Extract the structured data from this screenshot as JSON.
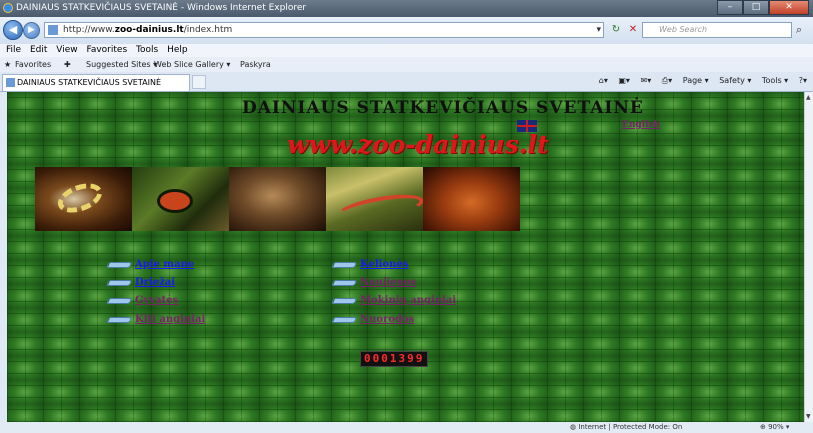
{
  "window": {
    "title": "DAINIAUS STATKEVIČIAUS SVETAINĖ - Windows Internet Explorer",
    "buttons": {
      "minimize": "–",
      "maximize": "□",
      "close": "✕"
    }
  },
  "address_bar": {
    "url_prefix": "http://www.",
    "url_domain": "zoo-dainius.lt",
    "url_path": "/index.htm",
    "search_placeholder": "Web Search"
  },
  "menu": [
    "File",
    "Edit",
    "View",
    "Favorites",
    "Tools",
    "Help"
  ],
  "favorites_bar": {
    "favorites_label": "Favorites",
    "items": [
      "Suggested Sites ▾",
      "Web Slice Gallery ▾",
      "Paskyra"
    ]
  },
  "tab": {
    "label": "DAINIAUS STATKEVIČIAUS SVETAINĖ"
  },
  "command_bar": [
    "Page ▾",
    "Safety ▾",
    "Tools ▾"
  ],
  "page": {
    "title": "DAINIAUS  STATKEVIČIAUS  SVETAINĖ",
    "logo": "www.zoo-dainius.lt",
    "english_link": "English",
    "left_links": [
      {
        "label": "Apie mane",
        "color": "#1a1aee"
      },
      {
        "label": "Driežai",
        "color": "#1a1aee"
      },
      {
        "label": "Gyvatės",
        "color": "#7a1f6a"
      },
      {
        "label": "Kiti anginiai",
        "color": "#7a1f6a"
      }
    ],
    "right_links": [
      {
        "label": "Kelionės",
        "color": "#1a1aee"
      },
      {
        "label": "Naujienos",
        "color": "#7a1f6a"
      },
      {
        "label": "Mokinių anginiai",
        "color": "#7a1f6a"
      },
      {
        "label": "Nuorodos",
        "color": "#7a1f6a"
      }
    ],
    "counter": "0001399"
  },
  "status_bar": {
    "zone": "Internet | Protected Mode: On",
    "zoom": "90%"
  }
}
